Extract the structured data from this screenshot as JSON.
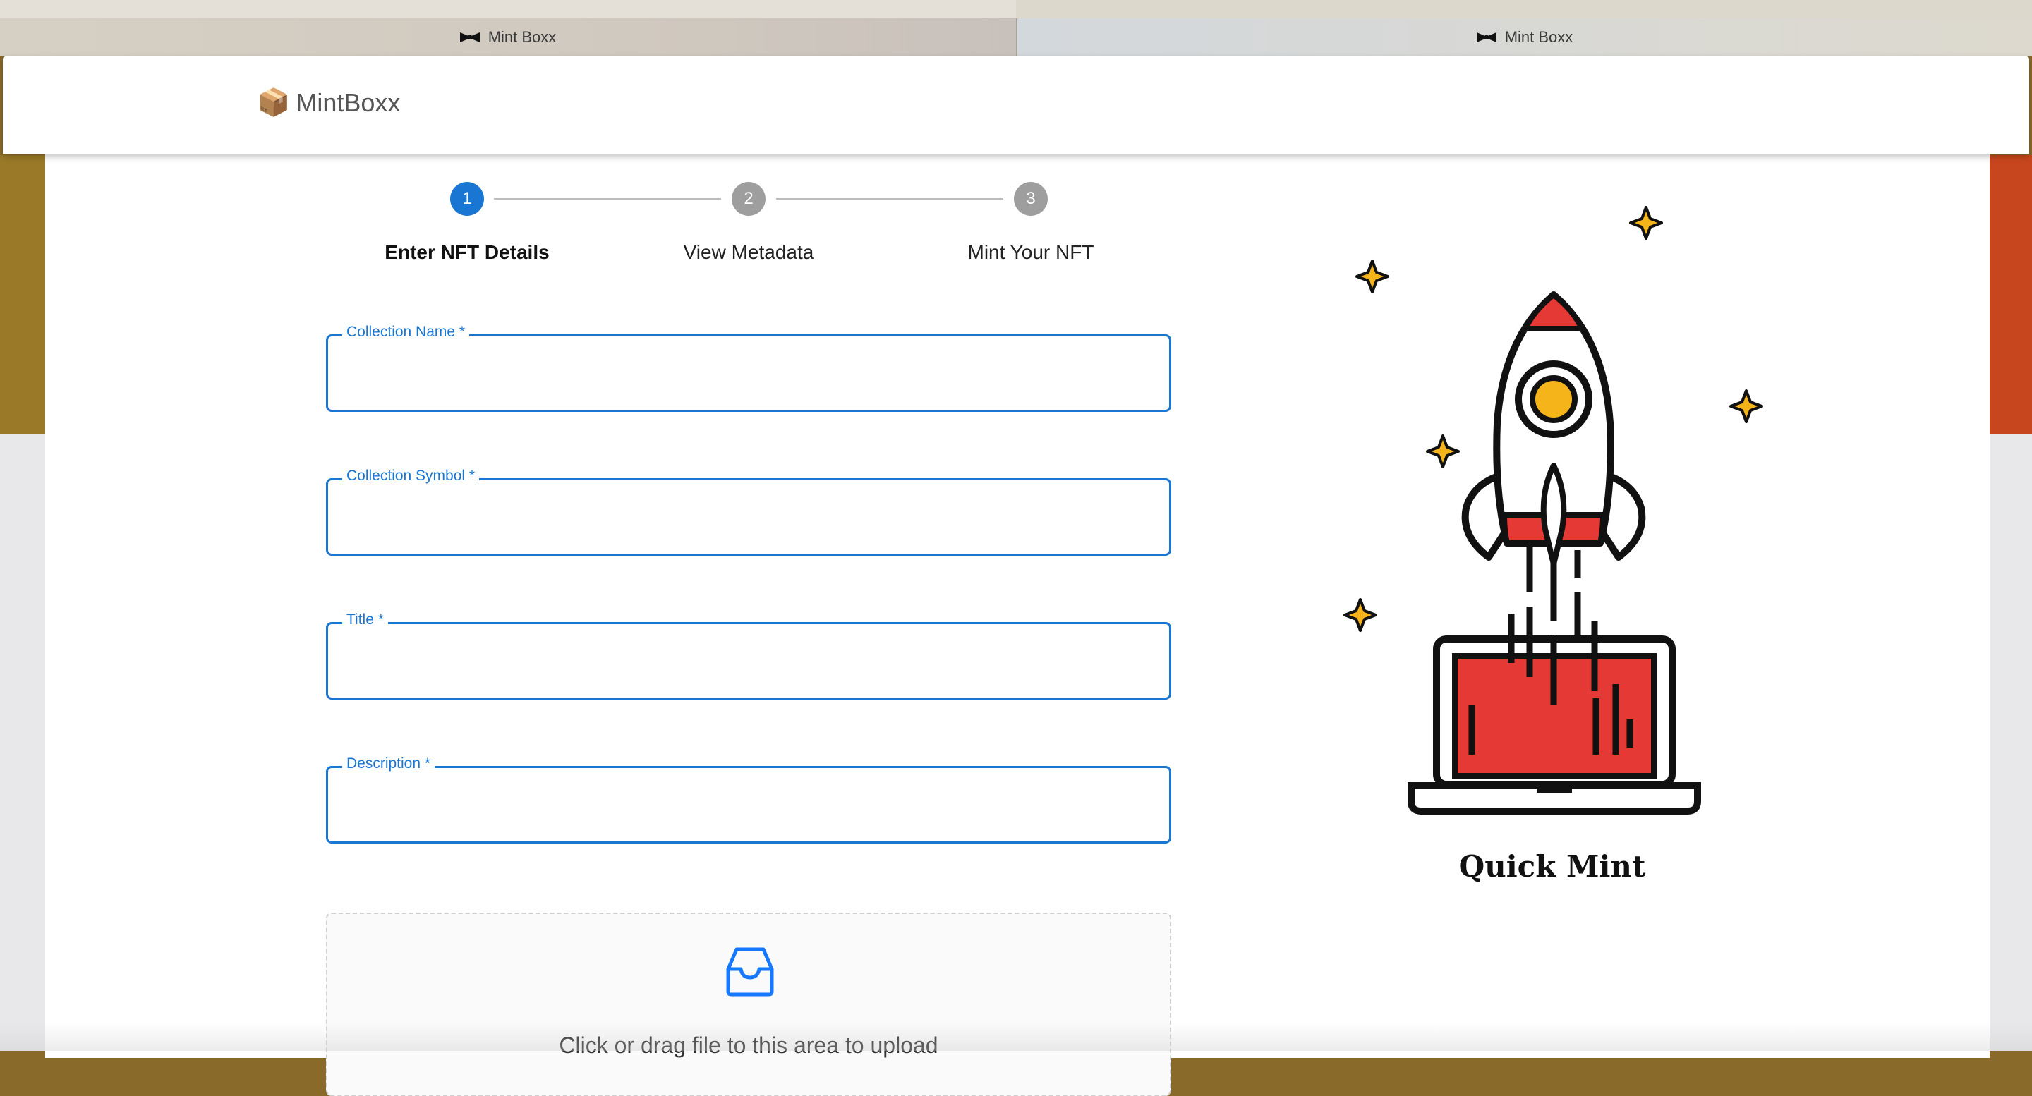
{
  "browser": {
    "tabs": [
      {
        "label": "Mint Boxx"
      },
      {
        "label": "Mint Boxx"
      }
    ]
  },
  "header": {
    "brand_icon": "📦",
    "brand_name": "MintBoxx"
  },
  "stepper": {
    "steps": [
      {
        "number": "1",
        "label": "Enter NFT Details",
        "state": "active"
      },
      {
        "number": "2",
        "label": "View Metadata",
        "state": "inactive"
      },
      {
        "number": "3",
        "label": "Mint Your NFT",
        "state": "inactive"
      }
    ]
  },
  "form": {
    "fields": [
      {
        "label": "Collection Name *",
        "value": ""
      },
      {
        "label": "Collection Symbol *",
        "value": ""
      },
      {
        "label": "Title *",
        "value": ""
      },
      {
        "label": "Description *",
        "value": ""
      }
    ],
    "upload": {
      "icon": "inbox-icon",
      "hint": "Click or drag file to this area to upload"
    }
  },
  "illustration": {
    "icon": "rocket-laptop-icon",
    "caption": "Quick Mint"
  },
  "colors": {
    "primary": "#1976d2",
    "inactive_step": "#9e9e9e",
    "rocket_red": "#e53935",
    "star_yellow": "#f4b41a"
  }
}
